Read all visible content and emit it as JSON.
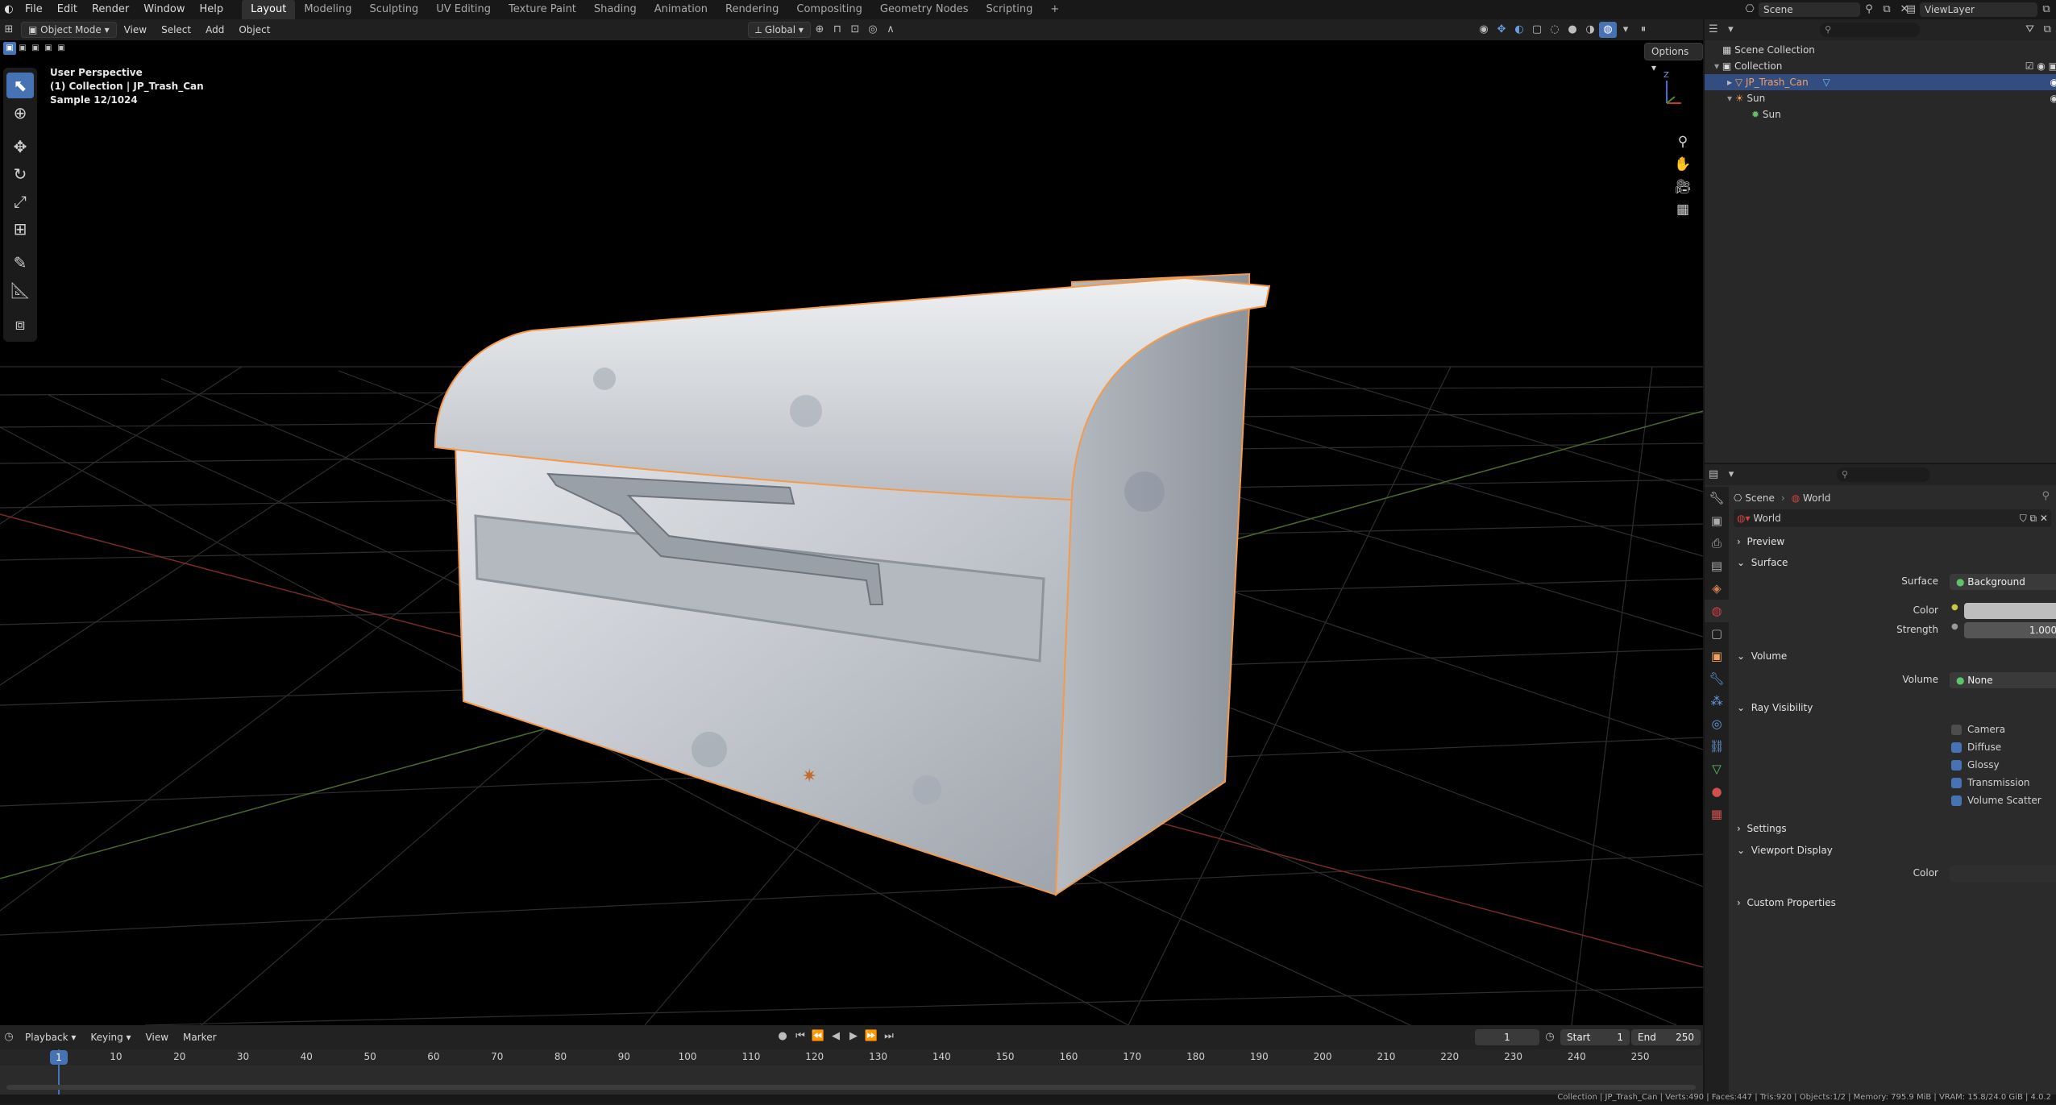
{
  "topbar": {
    "menus": [
      "File",
      "Edit",
      "Render",
      "Window",
      "Help"
    ],
    "workspaces": [
      "Layout",
      "Modeling",
      "Sculpting",
      "UV Editing",
      "Texture Paint",
      "Shading",
      "Animation",
      "Rendering",
      "Compositing",
      "Geometry Nodes",
      "Scripting"
    ],
    "active_workspace": "Layout",
    "add_tab": "+",
    "scene_name": "Scene",
    "view_layer": "ViewLayer"
  },
  "viewport_header": {
    "mode": "Object Mode",
    "menus": [
      "View",
      "Select",
      "Add",
      "Object"
    ],
    "orientation": "Global",
    "options": "Options"
  },
  "viewport": {
    "info_line1": "User Perspective",
    "info_line2": "(1) Collection | JP_Trash_Can",
    "info_line3": "Sample 12/1024",
    "gizmo_z": "Z",
    "tools": [
      "select-box",
      "cursor",
      "move",
      "rotate",
      "scale",
      "transform",
      "annotate",
      "measure",
      "add-cube"
    ],
    "active_tool": "select-box"
  },
  "outliner": {
    "root": "Scene Collection",
    "items": [
      {
        "label": "Collection",
        "depth": 1,
        "selected": false
      },
      {
        "label": "JP_Trash_Can",
        "depth": 2,
        "selected": true
      },
      {
        "label": "Sun",
        "depth": 2,
        "selected": false
      },
      {
        "label": "Sun",
        "depth": 3,
        "selected": false
      }
    ]
  },
  "properties": {
    "breadcrumb_scene": "Scene",
    "breadcrumb_world": "World",
    "world_name": "World",
    "sections": {
      "preview": "Preview",
      "surface": "Surface",
      "volume": "Volume",
      "ray_visibility": "Ray Visibility",
      "settings": "Settings",
      "viewport_display": "Viewport Display",
      "custom_properties": "Custom Properties"
    },
    "surface_label": "Surface",
    "surface_value": "Background",
    "color_label": "Color",
    "strength_label": "Strength",
    "strength_value": "1.000",
    "volume_label": "Volume",
    "volume_value": "None",
    "ray_visibility": [
      {
        "label": "Camera",
        "checked": false
      },
      {
        "label": "Diffuse",
        "checked": true
      },
      {
        "label": "Glossy",
        "checked": true
      },
      {
        "label": "Transmission",
        "checked": true
      },
      {
        "label": "Volume Scatter",
        "checked": true
      }
    ],
    "vd_color_label": "Color",
    "colors": {
      "world_color": "#bdbdbd",
      "vd_color": "#2f2f2f"
    }
  },
  "timeline": {
    "menus": [
      "Playback",
      "Keying",
      "View",
      "Marker"
    ],
    "current_frame": "1",
    "start_label": "Start",
    "start_value": "1",
    "end_label": "End",
    "end_value": "250",
    "ticks": [
      "1",
      "10",
      "20",
      "30",
      "40",
      "50",
      "60",
      "70",
      "80",
      "90",
      "100",
      "110",
      "120",
      "130",
      "140",
      "150",
      "160",
      "170",
      "180",
      "190",
      "200",
      "210",
      "220",
      "230",
      "240",
      "250"
    ]
  },
  "status_bar": {
    "text": "Collection | JP_Trash_Can | Verts:490 | Faces:447 | Tris:920 | Objects:1/2 | Memory: 795.9 MiB | VRAM: 15.8/24.0 GiB | 4.0.2"
  },
  "colors": {
    "accent": "#4772b3",
    "selection": "#334d80",
    "outline": "#f39a4c"
  }
}
